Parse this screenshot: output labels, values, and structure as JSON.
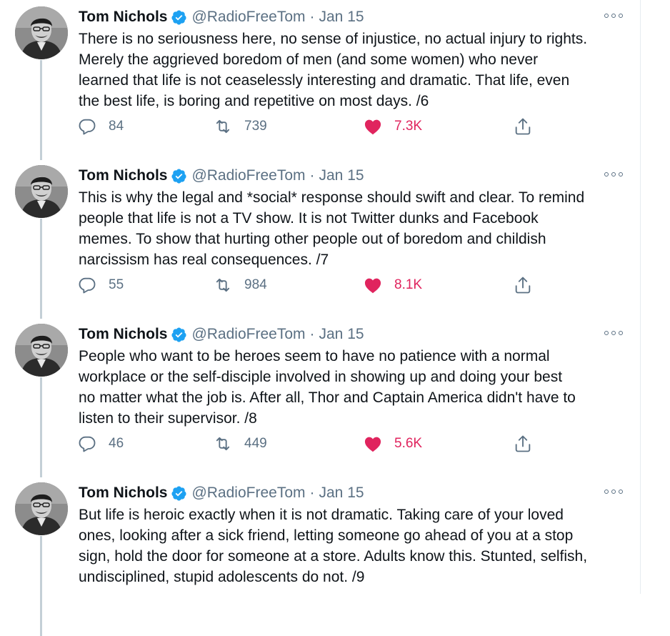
{
  "author": {
    "name": "Tom Nichols",
    "handle": "@RadioFreeTom",
    "separator": "·",
    "date": "Jan 15"
  },
  "colors": {
    "like": "#e0245e",
    "verified": "#1da1f2",
    "muted": "#5b7083",
    "thread_line": "#c4cfd6"
  },
  "icons": {
    "reply": "reply-icon",
    "retweet": "retweet-icon",
    "like": "heart-icon",
    "share": "share-icon",
    "more": "more-icon",
    "verified": "verified-badge-icon"
  },
  "tweets": [
    {
      "text": "There is no seriousness here, no sense of injustice, no actual injury to rights.\nMerely the aggrieved boredom of men (and some women) who never\nlearned that life is not ceaselessly interesting and dramatic. That life, even\nthe best life, is boring and repetitive on most days. /6",
      "replies": "84",
      "retweets": "739",
      "likes": "7.3K"
    },
    {
      "text": "This is why the legal and *social* response should swift and clear. To remind\npeople that life is not a TV show. It is not Twitter dunks and Facebook\nmemes. To show that hurting other people out of boredom and childish\nnarcissism has real consequences. /7",
      "replies": "55",
      "retweets": "984",
      "likes": "8.1K"
    },
    {
      "text": "People who want to be heroes seem to have no patience with a normal\nworkplace or the self-disciple involved in showing up and doing your best\nno matter what the job is. After all, Thor and Captain America didn't have to\nlisten to their supervisor. /8",
      "replies": "46",
      "retweets": "449",
      "likes": "5.6K"
    },
    {
      "text": "But life is heroic exactly when it is not dramatic. Taking care of your loved\nones, looking after a sick friend, letting someone go ahead of you at a stop\nsign, hold the door for someone at a store. Adults know this. Stunted, selfish,\nundisciplined, stupid adolescents do not.  /9",
      "replies": "",
      "retweets": "",
      "likes": ""
    }
  ]
}
